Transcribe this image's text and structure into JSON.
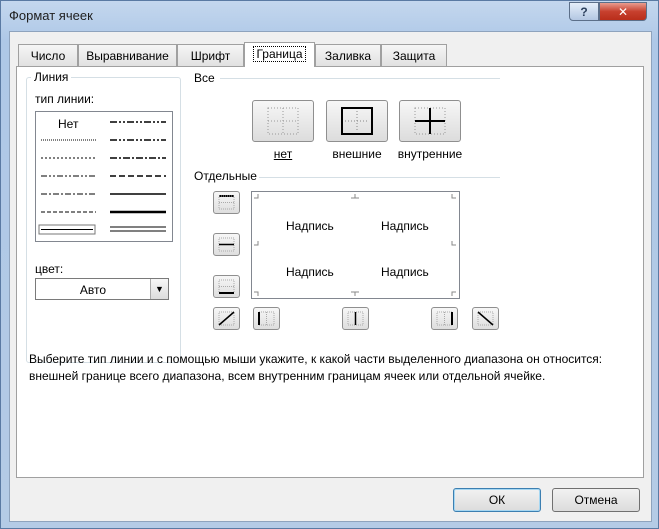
{
  "window": {
    "title": "Формат ячеек",
    "help_label": "?",
    "close_label": "✕"
  },
  "tabs": [
    {
      "label": "Число"
    },
    {
      "label": "Выравнивание"
    },
    {
      "label": "Шрифт"
    },
    {
      "label": "Граница",
      "active": true
    },
    {
      "label": "Заливка"
    },
    {
      "label": "Защита"
    }
  ],
  "line_group": {
    "title": "Линия",
    "style_label": "тип линии:",
    "none_label": "Нет",
    "color_label": "цвет:",
    "color_value": "Авто"
  },
  "presets": {
    "title": "Все",
    "items": [
      {
        "label": "нет",
        "icon": "border-none-icon"
      },
      {
        "label": "внешние",
        "icon": "border-outline-icon"
      },
      {
        "label": "внутренние",
        "icon": "border-inside-icon"
      }
    ]
  },
  "individual": {
    "title": "Отдельные",
    "preview_texts": [
      "Надпись",
      "Надпись",
      "Надпись",
      "Надпись"
    ]
  },
  "hint": {
    "line1": "Выберите тип линии и с помощью мыши укажите, к какой части выделенного диапазона он относится:",
    "line2": "внешней границе всего диапазона, всем внутренним границам ячеек или отдельной ячейке."
  },
  "buttons": {
    "ok": "ОК",
    "cancel": "Отмена"
  },
  "colors": {
    "accent_border": "#3c7fb1",
    "window_frame": "#b9d1ea",
    "close_red": "#c7402e"
  }
}
